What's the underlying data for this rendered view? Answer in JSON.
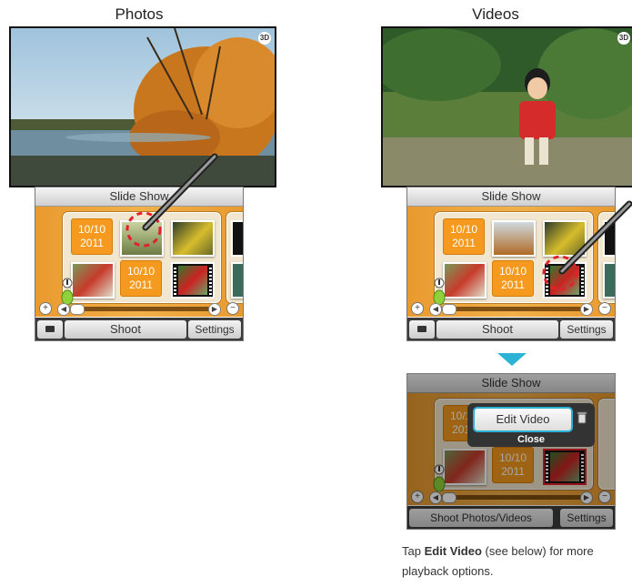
{
  "columns": {
    "photos_title": "Photos",
    "videos_title": "Videos"
  },
  "top_screen": {
    "badge_3d": "3D"
  },
  "bottom_ui": {
    "slideshow_label": "Slide Show",
    "date_line1": "10/10",
    "date_line2": "2011",
    "shoot_label": "Shoot",
    "settings_label": "Settings",
    "shoot_photos_videos_label": "Shoot Photos/Videos"
  },
  "edit_menu": {
    "edit_video_label": "Edit Video",
    "close_label": "Close"
  },
  "caption": {
    "prefix": "Tap ",
    "bold": "Edit Video",
    "suffix": " (see below) for more playback options."
  },
  "colors": {
    "accent": "#2bb3d6",
    "orange": "#f2b04a",
    "selection_red": "#e0232a"
  },
  "icons": [
    "camera-icon",
    "trash-icon",
    "stylus-icon",
    "microphone-icon",
    "3d-badge-icon",
    "zoom-in-icon",
    "zoom-out-icon",
    "arrow-down-icon"
  ]
}
